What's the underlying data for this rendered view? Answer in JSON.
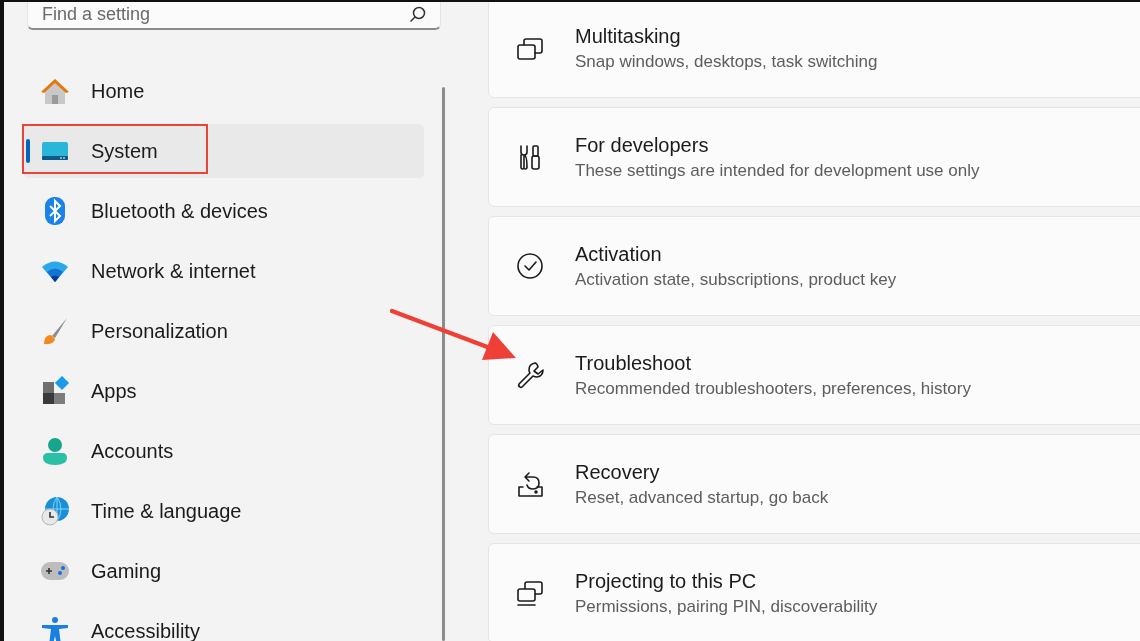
{
  "search": {
    "placeholder": "Find a setting"
  },
  "nav": [
    {
      "label": "Home",
      "kind": "home",
      "selected": false
    },
    {
      "label": "System",
      "kind": "system",
      "selected": true
    },
    {
      "label": "Bluetooth & devices",
      "kind": "bluetooth",
      "selected": false
    },
    {
      "label": "Network & internet",
      "kind": "network",
      "selected": false
    },
    {
      "label": "Personalization",
      "kind": "personalization",
      "selected": false
    },
    {
      "label": "Apps",
      "kind": "apps",
      "selected": false
    },
    {
      "label": "Accounts",
      "kind": "accounts",
      "selected": false
    },
    {
      "label": "Time & language",
      "kind": "time",
      "selected": false
    },
    {
      "label": "Gaming",
      "kind": "gaming",
      "selected": false
    },
    {
      "label": "Accessibility",
      "kind": "accessibility",
      "selected": false
    }
  ],
  "cards": [
    {
      "title": "Multitasking",
      "subtitle": "Snap windows, desktops, task switching",
      "kind": "windows"
    },
    {
      "title": "For developers",
      "subtitle": "These settings are intended for development use only",
      "kind": "tools"
    },
    {
      "title": "Activation",
      "subtitle": "Activation state, subscriptions, product key",
      "kind": "check"
    },
    {
      "title": "Troubleshoot",
      "subtitle": "Recommended troubleshooters, preferences, history",
      "kind": "wrench"
    },
    {
      "title": "Recovery",
      "subtitle": "Reset, advanced startup, go back",
      "kind": "recovery"
    },
    {
      "title": "Projecting to this PC",
      "subtitle": "Permissions, pairing PIN, discoverability",
      "kind": "projecting"
    }
  ]
}
